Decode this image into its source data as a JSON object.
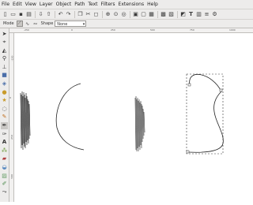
{
  "menubar": {
    "items": [
      "File",
      "Edit",
      "View",
      "Layer",
      "Object",
      "Path",
      "Text",
      "Filters",
      "Extensions",
      "Help"
    ]
  },
  "toolbar": {
    "icons": [
      "new-document-icon",
      "open-icon",
      "save-icon",
      "print-icon",
      "import-icon",
      "export-icon",
      "undo-icon",
      "redo-icon",
      "copy-icon",
      "cut-icon",
      "paste-icon",
      "zoom-selection-icon",
      "zoom-drawing-icon",
      "zoom-page-icon",
      "duplicate-icon",
      "clone-icon",
      "unlink-clone-icon",
      "group-icon",
      "ungroup-icon",
      "fill-stroke-icon",
      "text-font-icon",
      "xml-editor-icon",
      "align-icon",
      "preferences-icon"
    ]
  },
  "controls": {
    "mode_label": "Mode",
    "shape_label": "Shape",
    "shape_value": "None"
  },
  "ruler": {
    "h_labels": [
      "-250",
      "0",
      "250",
      "500",
      "750",
      "1000"
    ],
    "v_labels": [
      "-250",
      "0",
      "250",
      "500"
    ]
  },
  "tools": [
    "selector-tool",
    "node-tool",
    "tweak-tool",
    "zoom-tool",
    "measure-tool",
    "rectangle-tool",
    "3d-box-tool",
    "ellipse-tool",
    "star-tool",
    "spiral-tool",
    "pencil-tool",
    "pen-tool",
    "calligraphy-tool",
    "text-tool",
    "spray-tool",
    "eraser-tool",
    "bucket-tool",
    "gradient-tool",
    "dropper-tool",
    "connector-tool"
  ]
}
